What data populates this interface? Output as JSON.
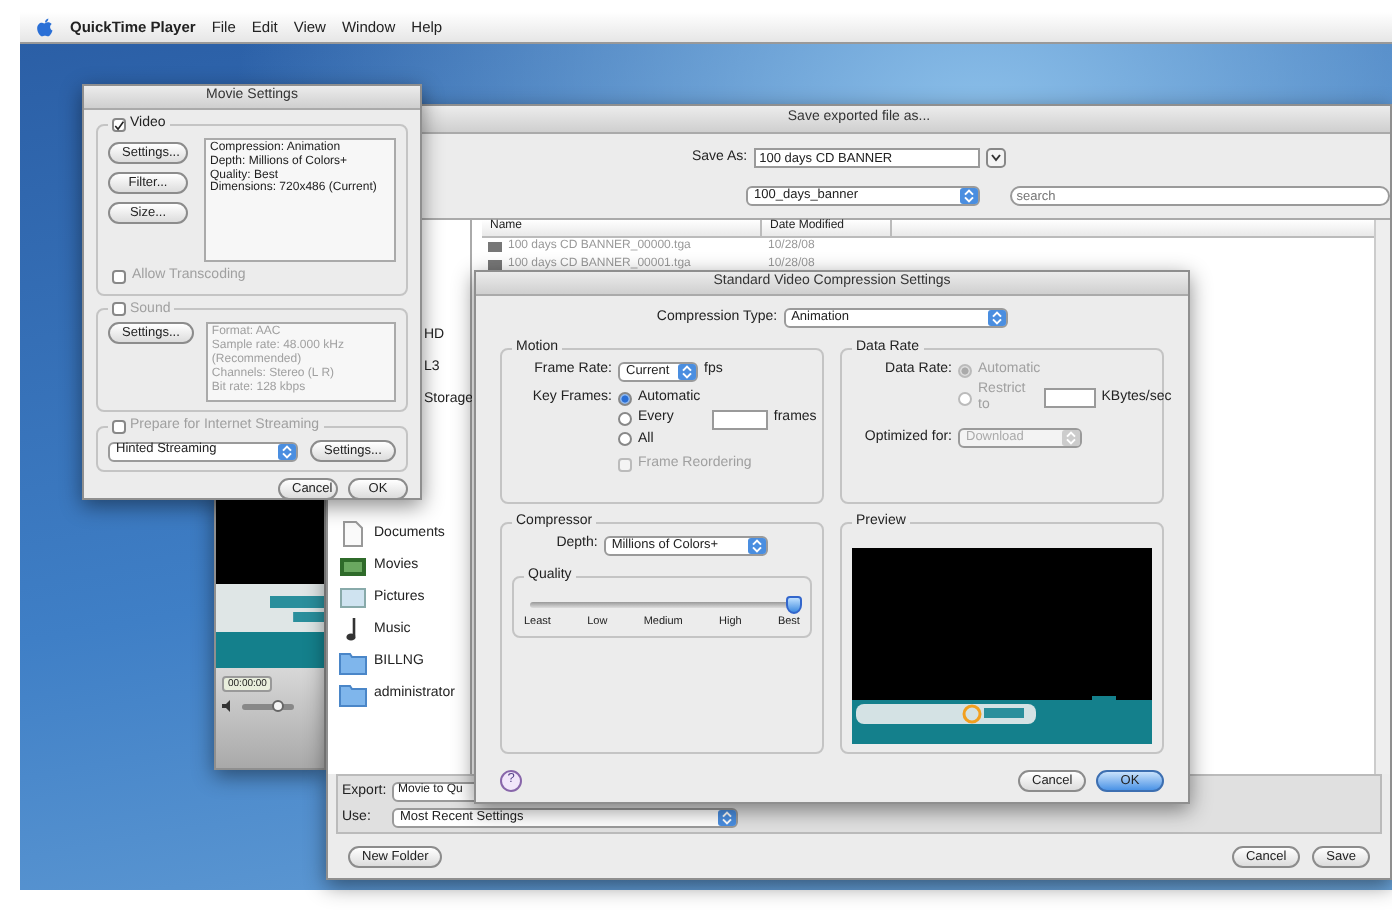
{
  "menu_bar": {
    "app_name": "QuickTime Player",
    "items": [
      "File",
      "Edit",
      "View",
      "Window",
      "Help"
    ]
  },
  "player_window": {
    "time": "00:00:00",
    "volume": {
      "level": 0.7
    }
  },
  "save_dialog": {
    "title": "Save exported file as...",
    "save_as_label": "Save As:",
    "save_as_value": "100 days CD BANNER",
    "location": "100_days_banner",
    "search_placeholder": "search",
    "columns": [
      "Name",
      "Date Modified"
    ],
    "files": [
      {
        "name": "100 days CD BANNER_00000.tga",
        "date": "10/28/08"
      },
      {
        "name": "100 days CD BANNER_00001.tga",
        "date": "10/28/08"
      }
    ],
    "sidebar": [
      {
        "kind": "device",
        "label": "HD"
      },
      {
        "kind": "device",
        "label": "L3"
      },
      {
        "kind": "device",
        "label": "Storage"
      },
      {
        "kind": "documents",
        "label": "Documents"
      },
      {
        "kind": "movies",
        "label": "Movies"
      },
      {
        "kind": "pictures",
        "label": "Pictures"
      },
      {
        "kind": "music",
        "label": "Music"
      },
      {
        "kind": "folder",
        "label": "BILLNG"
      },
      {
        "kind": "folder",
        "label": "administrator"
      }
    ],
    "export_label": "Export:",
    "export_value": "Movie to Qu",
    "use_label": "Use:",
    "use_value": "Most Recent Settings",
    "new_folder": "New Folder",
    "buttons": [
      "Cancel",
      "Save"
    ]
  },
  "movie_settings": {
    "title": "Movie Settings",
    "video": {
      "label": "Video",
      "checked": true,
      "buttons": [
        "Settings...",
        "Filter...",
        "Size..."
      ],
      "summary": [
        "Compression: Animation",
        "Depth: Millions of Colors+",
        "Quality: Best",
        "Dimensions: 720x486 (Current)"
      ],
      "allow_transcoding": {
        "label": "Allow Transcoding",
        "checked": false
      }
    },
    "sound": {
      "label": "Sound",
      "checked": false,
      "button": "Settings...",
      "summary": [
        "Format: AAC",
        "Sample rate: 48.000 kHz",
        "(Recommended)",
        "Channels: Stereo (L R)",
        "Bit rate: 128 kbps"
      ]
    },
    "streaming": {
      "label": "Prepare for Internet Streaming",
      "checked": false,
      "popup": "Hinted Streaming",
      "button": "Settings..."
    },
    "buttons": [
      "Cancel",
      "OK"
    ]
  },
  "compression": {
    "title": "Standard Video Compression Settings",
    "type_label": "Compression Type:",
    "type_value": "Animation",
    "motion": {
      "title": "Motion",
      "frame_rate_label": "Frame Rate:",
      "frame_rate": "Current",
      "fps": "fps",
      "key_frames_label": "Key Frames:",
      "key_frame_options": [
        {
          "label": "Automatic",
          "selected": true
        },
        {
          "label": "Every",
          "selected": false
        },
        {
          "label": "All",
          "selected": false
        }
      ],
      "frames_unit": "frames",
      "frame_reordering": {
        "label": "Frame Reordering",
        "checked": false,
        "disabled": true
      }
    },
    "data_rate": {
      "title": "Data Rate",
      "label": "Data Rate:",
      "disabled": true,
      "options": [
        {
          "label": "Automatic",
          "selected": true
        },
        {
          "label": "Restrict to",
          "selected": false
        }
      ],
      "unit": "KBytes/sec",
      "optimized_label": "Optimized for:",
      "optimized_value": "Download"
    },
    "compressor": {
      "title": "Compressor",
      "depth_label": "Depth:",
      "depth": "Millions of Colors+",
      "quality": {
        "title": "Quality",
        "level": 1.0,
        "ticks": [
          "Least",
          "Low",
          "Medium",
          "High",
          "Best"
        ]
      }
    },
    "preview": {
      "title": "Preview"
    },
    "help": "?",
    "buttons": [
      {
        "label": "Cancel",
        "default": false
      },
      {
        "label": "OK",
        "default": true
      }
    ]
  }
}
